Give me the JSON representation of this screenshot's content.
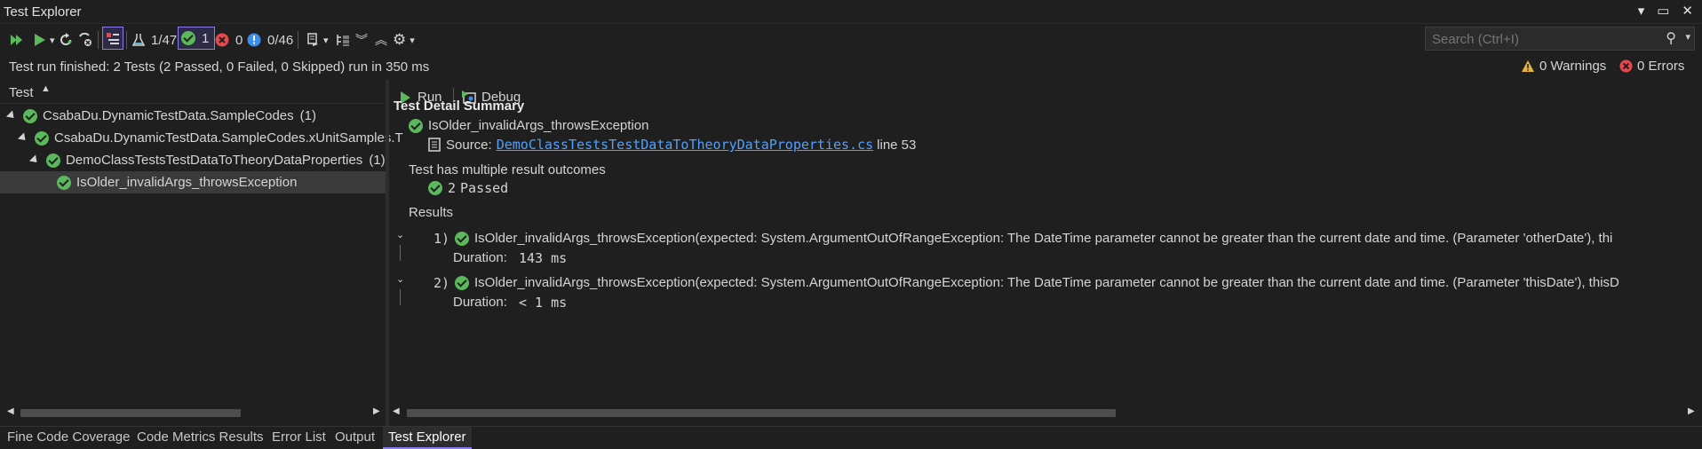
{
  "window": {
    "title": "Test Explorer"
  },
  "toolbar": {
    "total_tests": "1/47",
    "passed_count": "1",
    "failed_count": "0",
    "not_run_count": "0/46"
  },
  "search": {
    "placeholder": "Search (Ctrl+I)"
  },
  "status": {
    "summary": "Test run finished: 2 Tests (2 Passed, 0 Failed, 0 Skipped) run in 350 ms",
    "warnings": "0 Warnings",
    "errors": "0 Errors"
  },
  "tree": {
    "header": "Test",
    "items": [
      {
        "label": "CsabaDu.DynamicTestData.SampleCodes",
        "count": "(1)"
      },
      {
        "label": "CsabaDu.DynamicTestData.SampleCodes.xUnitSamples.T",
        "count": ""
      },
      {
        "label": "DemoClassTestsTestDataToTheoryDataProperties",
        "count": "(1)"
      },
      {
        "label": "IsOlder_invalidArgs_throwsException",
        "count": ""
      }
    ]
  },
  "detail": {
    "run_label": "Run",
    "debug_label": "Debug",
    "summary_heading": "Test Detail Summary",
    "test_name": "IsOlder_invalidArgs_throwsException",
    "source_label": "Source:",
    "source_file": "DemoClassTestsTestDataToTheoryDataProperties.cs",
    "source_line": "line 53",
    "outcomes_heading": "Test has multiple result outcomes",
    "passed_count": "2",
    "passed_label": "Passed",
    "results_heading": "Results",
    "results": [
      {
        "index": "1)",
        "text": "IsOlder_invalidArgs_throwsException(expected: System.ArgumentOutOfRangeException: The DateTime parameter cannot be greater than the current date and time. (Parameter 'otherDate'), thi",
        "duration_label": "Duration:",
        "duration": "143 ms"
      },
      {
        "index": "2)",
        "text": "IsOlder_invalidArgs_throwsException(expected: System.ArgumentOutOfRangeException: The DateTime parameter cannot be greater than the current date and time. (Parameter 'thisDate'), thisD",
        "duration_label": "Duration:",
        "duration": "< 1 ms"
      }
    ]
  },
  "bottom_tabs": [
    "Fine Code Coverage",
    "Code Metrics Results",
    "Error List",
    "Output",
    "Test Explorer"
  ],
  "colors": {
    "pass": "#5cb85c",
    "fail": "#e5484d",
    "info": "#3b8eea",
    "link": "#4ea1ff",
    "accent": "#8a7cf0"
  }
}
